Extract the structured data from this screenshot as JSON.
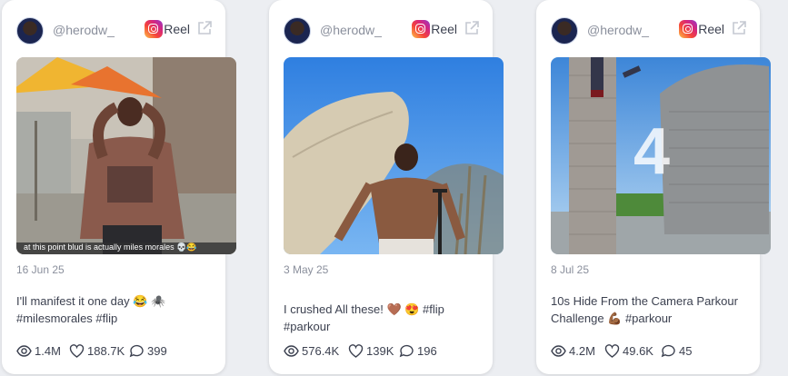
{
  "cards": [
    {
      "handle": "@herodw_",
      "platform": "Reel",
      "overlay_text": "at this point blud is actually miles morales 💀😂",
      "date": "16 Jun 25",
      "caption_line1": "I'll manifest it one day 😂 🕷️",
      "caption_line2": "#milesmorales #flip",
      "views": "1.4M",
      "likes": "188.7K",
      "comments": "399"
    },
    {
      "handle": "@herodw_",
      "platform": "Reel",
      "date": "3 May 25",
      "caption_line1": "I crushed All these! 🤎 😍 #flip #parkour",
      "caption_line2": "",
      "views": "576.4K",
      "likes": "139K",
      "comments": "196"
    },
    {
      "handle": "@herodw_",
      "platform": "Reel",
      "overlay_number": "4",
      "date": "8 Jul 25",
      "caption_line1": "10s Hide From the Camera Parkour",
      "caption_line2": "Challenge 💪🏾 #parkour",
      "views": "4.2M",
      "likes": "49.6K",
      "comments": "45"
    }
  ],
  "icons": {
    "platform": "instagram-icon",
    "external": "external-link-icon",
    "views": "eye-icon",
    "likes": "heart-icon",
    "comments": "comment-icon"
  },
  "colors": {
    "text": "#3c4150",
    "muted": "#8a8f9c",
    "card": "#ffffff",
    "background": "#eceef2"
  }
}
